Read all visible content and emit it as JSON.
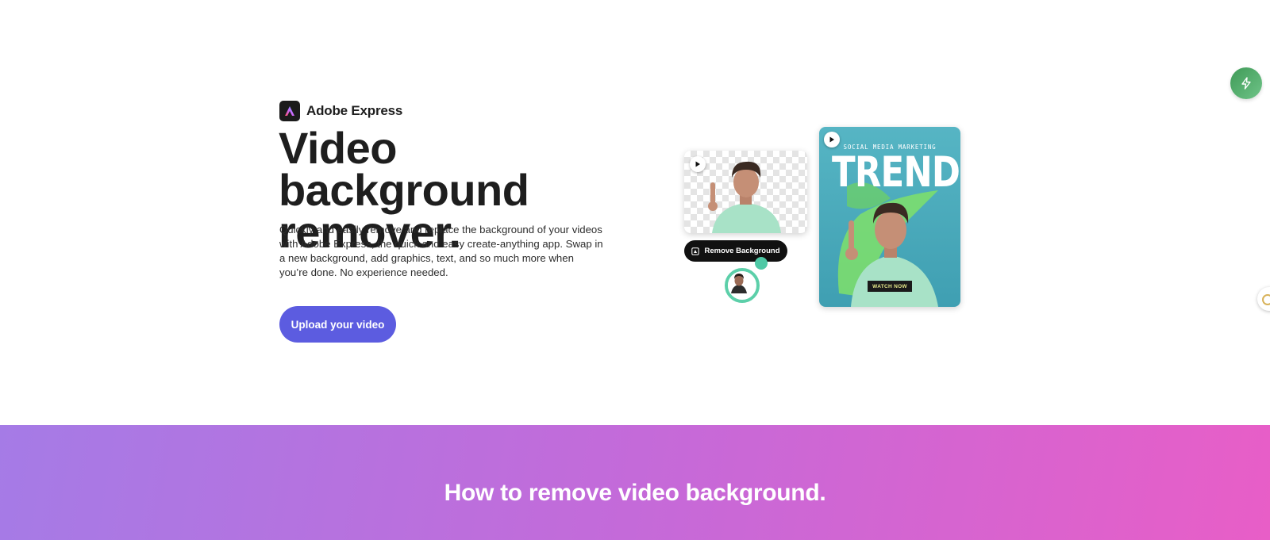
{
  "brand": {
    "name": "Adobe Express",
    "logo_icon": "adobe-express-logo"
  },
  "hero": {
    "title": "Video background remover.",
    "description": "Quickly and easily remove and replace the background of your videos with Adobe Express, the quick and easy create-anything app. Swap in a new background, add graphics, text, and so much more when you’re done. No experience needed.",
    "cta_label": "Upload your video"
  },
  "illustration": {
    "remove_bg_label": "Remove Background",
    "card_eyebrow": "SOCIAL MEDIA MARKETING",
    "card_title": "TRENDS",
    "card_cta": "WATCH NOW"
  },
  "section": {
    "title": "How to remove video background."
  },
  "colors": {
    "accent": "#5c5ce0",
    "band_start": "#a57be6",
    "band_end": "#e85ec7",
    "shirt": "#a6e0c5",
    "assistant": "#4fa866"
  },
  "icons": {
    "float_button": "lightning-icon",
    "play": "play-icon"
  }
}
